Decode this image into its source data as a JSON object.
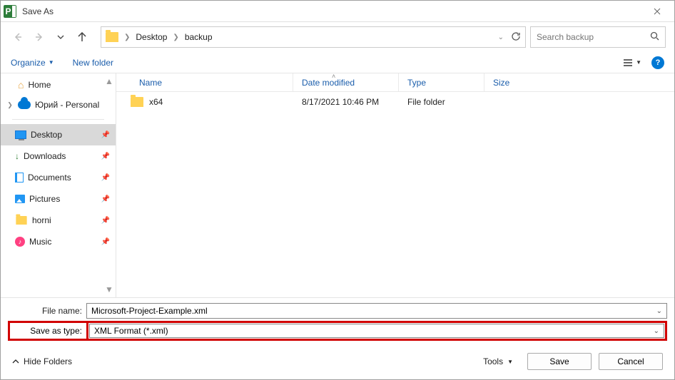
{
  "title": "Save As",
  "breadcrumb": {
    "parts": [
      "Desktop",
      "backup"
    ]
  },
  "search": {
    "placeholder": "Search backup"
  },
  "toolbar": {
    "organize": "Organize",
    "newfolder": "New folder"
  },
  "columns": {
    "name": "Name",
    "date": "Date modified",
    "type": "Type",
    "size": "Size"
  },
  "rows": [
    {
      "name": "x64",
      "date": "8/17/2021 10:46 PM",
      "type": "File folder",
      "size": ""
    }
  ],
  "sidebar": {
    "home": "Home",
    "onedrive": "Юрий - Personal",
    "quick": [
      {
        "key": "desktop",
        "label": "Desktop",
        "selected": true
      },
      {
        "key": "downloads",
        "label": "Downloads",
        "selected": false
      },
      {
        "key": "documents",
        "label": "Documents",
        "selected": false
      },
      {
        "key": "pictures",
        "label": "Pictures",
        "selected": false
      },
      {
        "key": "horni",
        "label": "horni",
        "selected": false
      },
      {
        "key": "music",
        "label": "Music",
        "selected": false
      }
    ]
  },
  "filename": {
    "label": "File name:",
    "value": "Microsoft-Project-Example.xml"
  },
  "filetype": {
    "label": "Save as type:",
    "value": "XML Format (*.xml)"
  },
  "footer": {
    "hide": "Hide Folders",
    "tools": "Tools",
    "save": "Save",
    "cancel": "Cancel"
  }
}
